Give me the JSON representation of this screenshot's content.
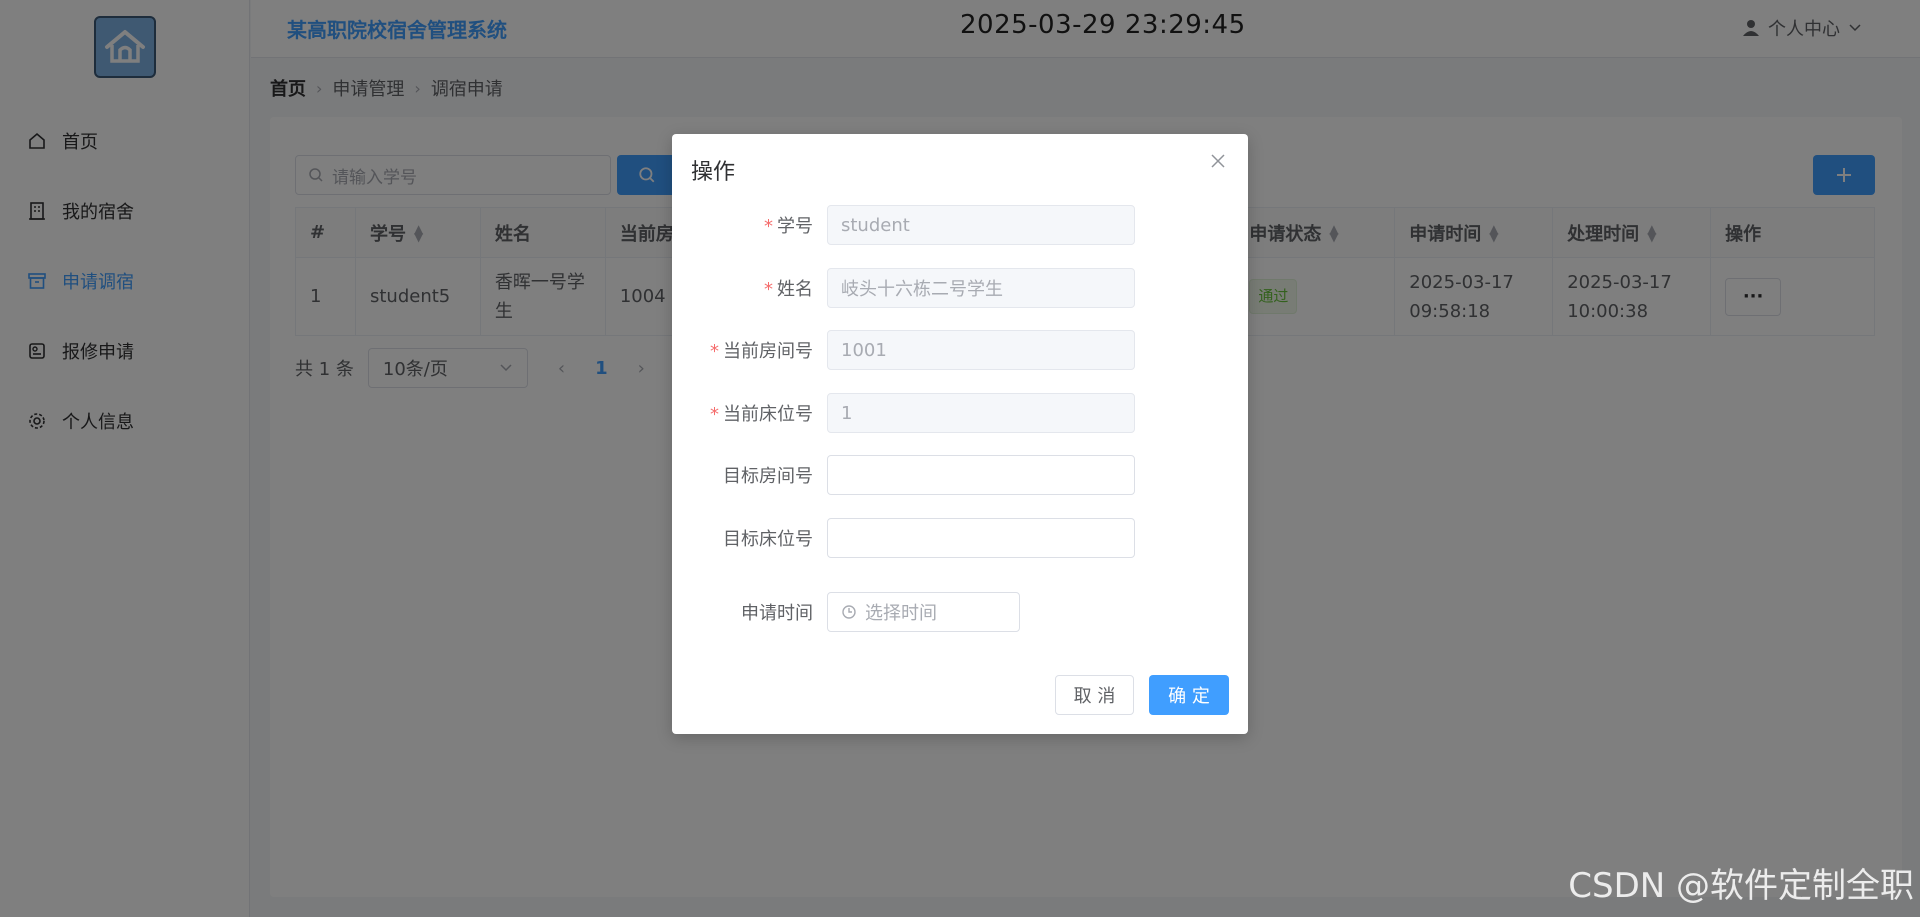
{
  "header": {
    "system_title": "某高职院校宿舍管理系统",
    "clock": "2025-03-29 23:29:45",
    "user_menu": "个人中心"
  },
  "sidebar": {
    "items": [
      {
        "label": "首页",
        "icon": "home-icon"
      },
      {
        "label": "我的宿舍",
        "icon": "building-icon"
      },
      {
        "label": "申请调宿",
        "icon": "archive-icon",
        "active": true
      },
      {
        "label": "报修申请",
        "icon": "repair-icon"
      },
      {
        "label": "个人信息",
        "icon": "gear-icon"
      }
    ]
  },
  "breadcrumb": [
    "首页",
    "申请管理",
    "调宿申请"
  ],
  "search": {
    "placeholder": "请输入学号"
  },
  "table": {
    "columns": [
      "#",
      "学号",
      "姓名",
      "当前房",
      "申请状态",
      "申请时间",
      "处理时间",
      "操作"
    ],
    "rows": [
      {
        "index": "1",
        "student_id": "student5",
        "name": "香晖一号学生",
        "room": "1004",
        "status": "通过",
        "apply_date": "2025-03-17",
        "apply_time": "09:58:18",
        "handle_date": "2025-03-17",
        "handle_time": "10:00:38",
        "action": "···"
      }
    ]
  },
  "pagination": {
    "total": "共 1 条",
    "page_size": "10条/页",
    "current": "1"
  },
  "dialog": {
    "title": "操作",
    "fields": {
      "student_id": {
        "label": "学号",
        "value": "student"
      },
      "name": {
        "label": "姓名",
        "value": "岐头十六栋二号学生"
      },
      "current_room": {
        "label": "当前房间号",
        "value": "1001"
      },
      "current_bed": {
        "label": "当前床位号",
        "value": "1"
      },
      "target_room": {
        "label": "目标房间号",
        "value": ""
      },
      "target_bed": {
        "label": "目标床位号",
        "value": ""
      },
      "apply_time": {
        "label": "申请时间",
        "placeholder": "选择时间"
      }
    },
    "cancel_label": "取 消",
    "ok_label": "确 定"
  },
  "watermark": "CSDN @软件定制全职",
  "colors": {
    "primary": "#409eff",
    "success": "#67c23a",
    "danger": "#f56c6c"
  }
}
